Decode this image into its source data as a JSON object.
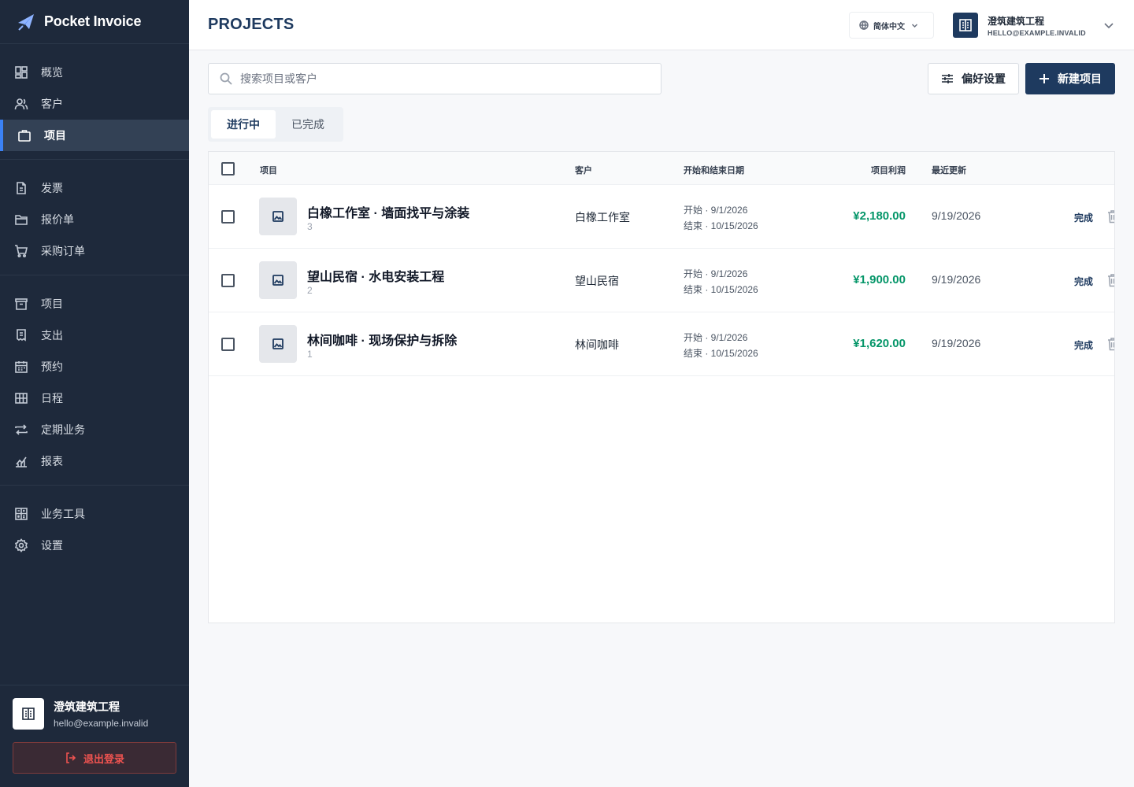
{
  "app": {
    "name": "Pocket Invoice"
  },
  "sidebar": {
    "groups": [
      [
        {
          "label": "概览",
          "icon": "dashboard-icon"
        },
        {
          "label": "客户",
          "icon": "users-icon"
        },
        {
          "label": "项目",
          "icon": "briefcase-icon",
          "active": true
        }
      ],
      [
        {
          "label": "发票",
          "icon": "document-icon"
        },
        {
          "label": "报价单",
          "icon": "folder-icon"
        },
        {
          "label": "采购订单",
          "icon": "cart-icon"
        }
      ],
      [
        {
          "label": "项目",
          "icon": "archive-icon"
        },
        {
          "label": "支出",
          "icon": "receipt-icon"
        },
        {
          "label": "预约",
          "icon": "calendar-icon"
        },
        {
          "label": "日程",
          "icon": "grid-icon"
        },
        {
          "label": "定期业务",
          "icon": "repeat-icon"
        },
        {
          "label": "报表",
          "icon": "chart-icon"
        }
      ],
      [
        {
          "label": "业务工具",
          "icon": "calculator-icon"
        },
        {
          "label": "设置",
          "icon": "gear-icon"
        }
      ]
    ],
    "account": {
      "name": "澄筑建筑工程",
      "email": "hello@example.invalid"
    },
    "logout_label": "退出登录"
  },
  "header": {
    "title": "PROJECTS",
    "language": "简体中文",
    "company_name": "澄筑建筑工程",
    "company_email": "HELLO@EXAMPLE.INVALID"
  },
  "toolbar": {
    "search_placeholder": "搜索项目或客户",
    "preferences_label": "偏好设置",
    "new_project_label": "新建项目"
  },
  "tabs": [
    {
      "label": "进行中",
      "active": true
    },
    {
      "label": "已完成",
      "active": false
    }
  ],
  "table": {
    "columns": {
      "project": "项目",
      "client": "客户",
      "dates": "开始和结束日期",
      "profit": "项目利润",
      "updated": "最近更新"
    },
    "rows": [
      {
        "name": "白橡工作室 · 墙面找平与涂装",
        "count": "3",
        "client": "白橡工作室",
        "start": "开始 · 9/1/2026",
        "end": "结束 · 10/15/2026",
        "profit": "¥2,180.00",
        "updated": "9/19/2026",
        "action": "完成"
      },
      {
        "name": "望山民宿 · 水电安装工程",
        "count": "2",
        "client": "望山民宿",
        "start": "开始 · 9/1/2026",
        "end": "结束 · 10/15/2026",
        "profit": "¥1,900.00",
        "updated": "9/19/2026",
        "action": "完成"
      },
      {
        "name": "林间咖啡 · 现场保护与拆除",
        "count": "1",
        "client": "林间咖啡",
        "start": "开始 · 9/1/2026",
        "end": "结束 · 10/15/2026",
        "profit": "¥1,620.00",
        "updated": "9/19/2026",
        "action": "完成"
      }
    ]
  },
  "colors": {
    "sidebar": "#1e293b",
    "primary": "#1e3a5f",
    "accent": "#3b82f6",
    "profit": "#059669",
    "danger": "#ef5350"
  }
}
